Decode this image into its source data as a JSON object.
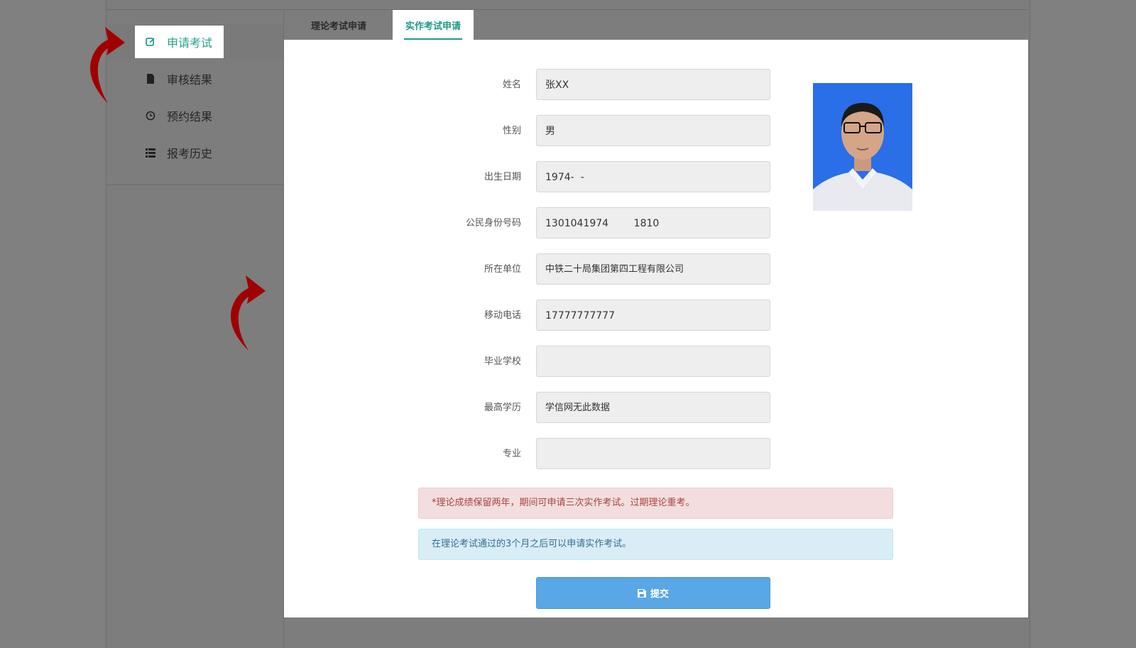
{
  "sidebar": {
    "items": [
      {
        "label": "申请考试",
        "icon": "edit-icon",
        "active": true
      },
      {
        "label": "审核结果",
        "icon": "file-icon",
        "active": false
      },
      {
        "label": "预约结果",
        "icon": "clock-icon",
        "active": false
      },
      {
        "label": "报考历史",
        "icon": "list-icon",
        "active": false
      }
    ]
  },
  "tabs": [
    {
      "label": "理论考试申请",
      "active": false
    },
    {
      "label": "实作考试申请",
      "active": true
    }
  ],
  "form": {
    "fields": [
      {
        "label": "姓名",
        "value": "张XX"
      },
      {
        "label": "性别",
        "value": "男"
      },
      {
        "label": "出生日期",
        "value": "1974-  -"
      },
      {
        "label": "公民身份号码",
        "value": "1301041974        1810"
      },
      {
        "label": "所在单位",
        "value": "中铁二十局集团第四工程有限公司"
      },
      {
        "label": "移动电话",
        "value": "17777777777"
      },
      {
        "label": "毕业学校",
        "value": ""
      },
      {
        "label": "最高学历",
        "value": "学信网无此数据"
      },
      {
        "label": "专业",
        "value": ""
      }
    ]
  },
  "alerts": {
    "danger": "*理论成绩保留两年，期间可申请三次实作考试。过期理论重考。",
    "info": "在理论考试通过的3个月之后可以申请实作考试。"
  },
  "submit": {
    "label": "提交",
    "icon": "save-icon"
  },
  "colors": {
    "accent": "#1e9a86",
    "overlay": "#808080",
    "submit_bg": "#5aa7e5",
    "annotation_arrow": "#a00000",
    "photo_bg": "#2a6ee8"
  }
}
